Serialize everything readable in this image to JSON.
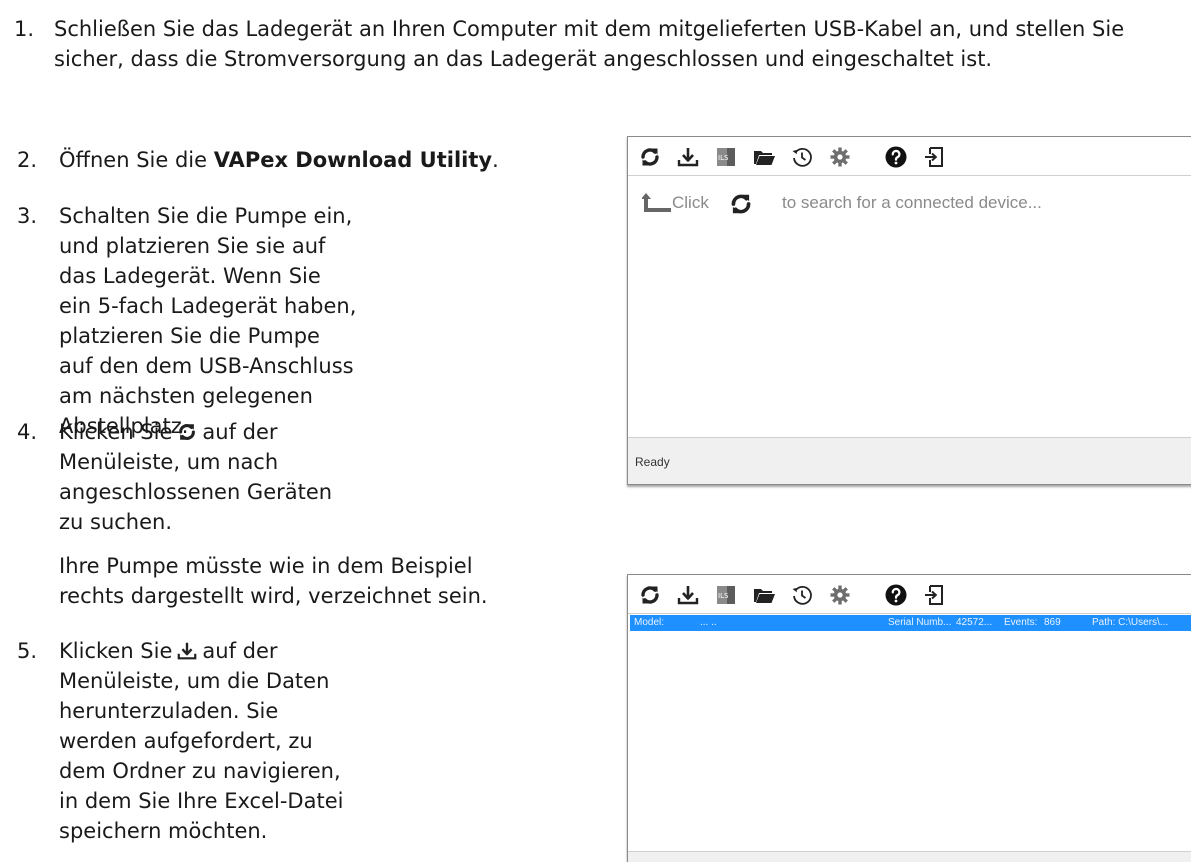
{
  "steps": [
    {
      "num": "1.",
      "text": "Schließen Sie das Ladegerät an Ihren Computer mit dem mitgelieferten USB-Kabel an, und stellen Sie sicher, dass die Stromversorgung an das Ladegerät angeschlossen und eingeschaltet ist."
    },
    {
      "num": "2.",
      "pre": "Öffnen Sie die ",
      "bold": "VAPex Download Utility",
      "post": "."
    },
    {
      "num": "3.",
      "text": "Schalten Sie die Pumpe ein, und platzieren Sie sie auf das Ladegerät. Wenn Sie ein 5-fach Ladegerät haben, platzieren Sie die Pumpe auf den dem USB-Anschluss am nächsten gelegenen Abstellplatz."
    },
    {
      "num": "4.",
      "pre": "Klicken Sie",
      "post": "auf der Menüleiste, um nach angeschlossenen Geräten zu suchen.",
      "icon": "refresh-icon"
    },
    {
      "note": "Ihre Pumpe müsste wie in dem Beispiel rechts dargestellt wird, verzeichnet sein."
    },
    {
      "num": "5.",
      "pre": "Klicken Sie",
      "post": "auf der Menüleiste, um die Daten herunterzuladen. Sie werden aufgefordert, zu dem Ordner zu navigieren, in dem Sie Ihre Excel-Datei speichern möchten.",
      "icon": "download-icon"
    }
  ],
  "screenshot1": {
    "toolbar_icons": [
      "refresh-icon",
      "download-icon",
      "ils-icon",
      "folder-open-icon",
      "history-icon",
      "settings-icon",
      "help-icon",
      "exit-icon"
    ],
    "hint_click": "Click",
    "hint_message": "to search for a connected device...",
    "status": "Ready"
  },
  "screenshot2": {
    "toolbar_icons": [
      "refresh-icon",
      "download-icon",
      "ils-icon",
      "folder-open-icon",
      "history-icon",
      "settings-icon",
      "help-icon",
      "exit-icon"
    ],
    "device_row": {
      "model_label": "Model:",
      "model_value": "... ..",
      "serial_label": "Serial Numb...",
      "serial_value": "42572...",
      "events_label": "Events:",
      "events_value": "869",
      "path": "Path: C:\\Users\\..."
    }
  },
  "colors": {
    "accent": "#1e90ff",
    "text": "#1a1a1a",
    "hint": "#8a8a8a",
    "icon": "#222222",
    "status_bg": "#f0f0f0"
  }
}
